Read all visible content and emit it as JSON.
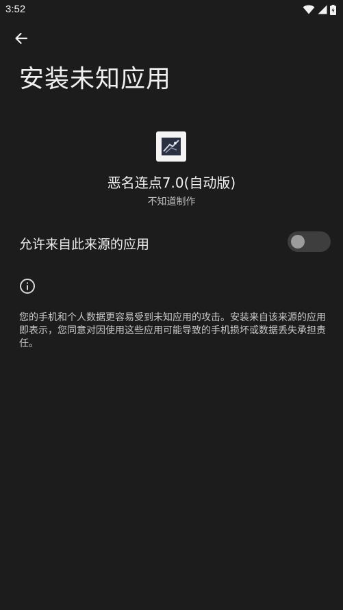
{
  "status_bar": {
    "time": "3:52",
    "icons": [
      "wifi-icon",
      "cellular-signal-icon",
      "battery-icon"
    ]
  },
  "header": {
    "back_icon": "arrow-left-icon",
    "title": "安装未知应用"
  },
  "app": {
    "icon": "app-icon",
    "name": "恶名连点7.0(自动版)",
    "source": "不知道制作"
  },
  "setting": {
    "label": "允许来自此来源的应用",
    "toggle_on": false
  },
  "info": {
    "icon": "info-icon",
    "text": "您的手机和个人数据更容易受到未知应用的攻击。安装来自该来源的应用即表示，您同意对因使用这些应用可能导致的手机损坏或数据丢失承担责任。"
  },
  "colors": {
    "background": "#1c1c1c",
    "text_primary": "#f0f0f0",
    "text_secondary": "#c9c9c9",
    "toggle_track": "#3e3e3e",
    "toggle_thumb": "#9c9c9c"
  }
}
